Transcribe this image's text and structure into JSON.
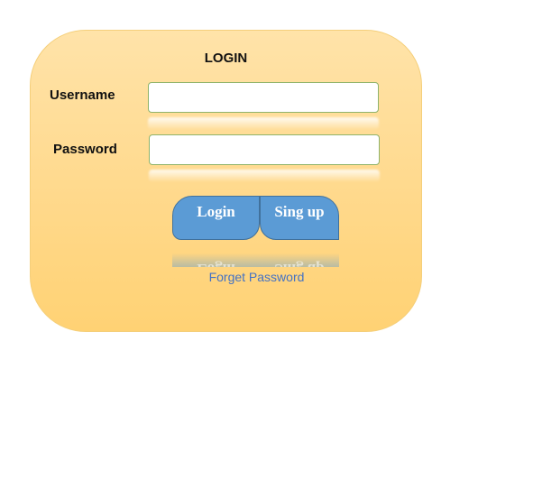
{
  "login_form": {
    "title": "LOGIN",
    "username_label": "Username",
    "username_value": "",
    "password_label": "Password",
    "password_value": "",
    "login_button": "Login",
    "signup_button": "Sing up",
    "forget_password_link": "Forget Password"
  },
  "colors": {
    "panel_top": "#ffe3a9",
    "panel_bottom": "#ffd274",
    "button_fill": "#5b9bd5",
    "button_border": "#41719c",
    "link": "#4472c4",
    "input_border": "#8fb36a"
  }
}
